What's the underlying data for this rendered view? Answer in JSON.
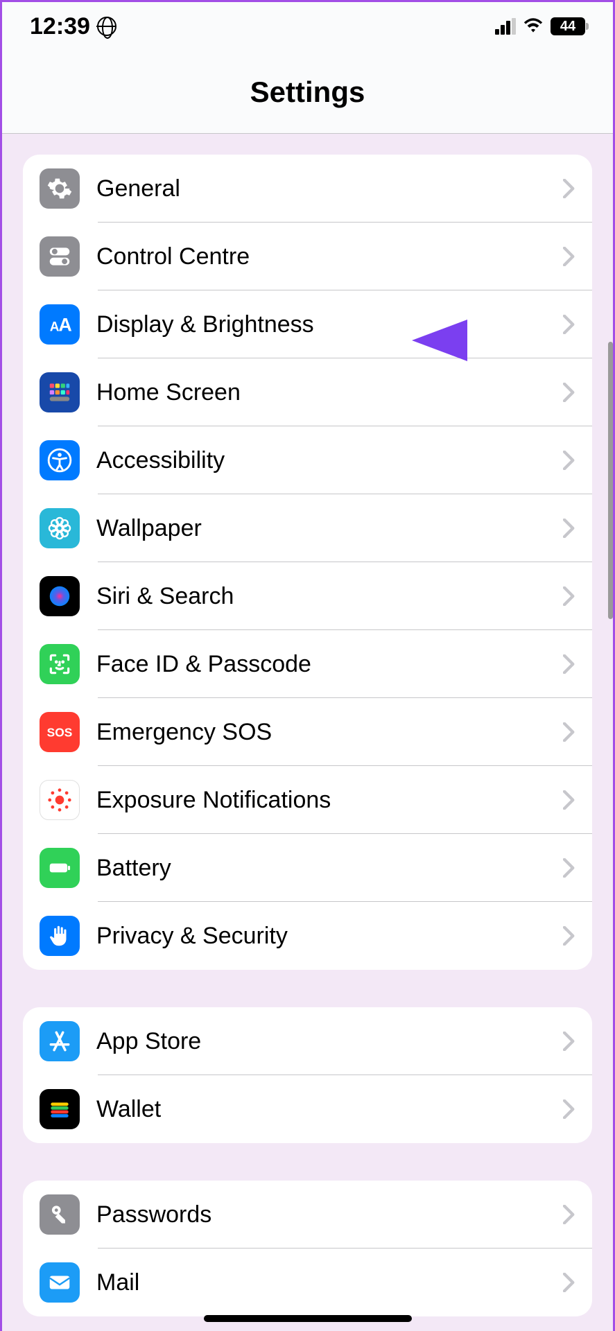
{
  "statusbar": {
    "time": "12:39",
    "battery_text": "44"
  },
  "title": "Settings",
  "groups": [
    {
      "items": [
        {
          "id": "general",
          "label": "General"
        },
        {
          "id": "control-centre",
          "label": "Control Centre"
        },
        {
          "id": "display-brightness",
          "label": "Display & Brightness"
        },
        {
          "id": "home-screen",
          "label": "Home Screen"
        },
        {
          "id": "accessibility",
          "label": "Accessibility"
        },
        {
          "id": "wallpaper",
          "label": "Wallpaper"
        },
        {
          "id": "siri-search",
          "label": "Siri & Search"
        },
        {
          "id": "face-id-passcode",
          "label": "Face ID & Passcode"
        },
        {
          "id": "emergency-sos",
          "label": "Emergency SOS"
        },
        {
          "id": "exposure-notifications",
          "label": "Exposure Notifications"
        },
        {
          "id": "battery",
          "label": "Battery"
        },
        {
          "id": "privacy-security",
          "label": "Privacy & Security"
        }
      ]
    },
    {
      "items": [
        {
          "id": "app-store",
          "label": "App Store"
        },
        {
          "id": "wallet",
          "label": "Wallet"
        }
      ]
    },
    {
      "items": [
        {
          "id": "passwords",
          "label": "Passwords"
        },
        {
          "id": "mail",
          "label": "Mail"
        }
      ]
    }
  ],
  "annotation": {
    "arrow_points_to": "Display & Brightness",
    "arrow_color": "#7b3ff0"
  }
}
